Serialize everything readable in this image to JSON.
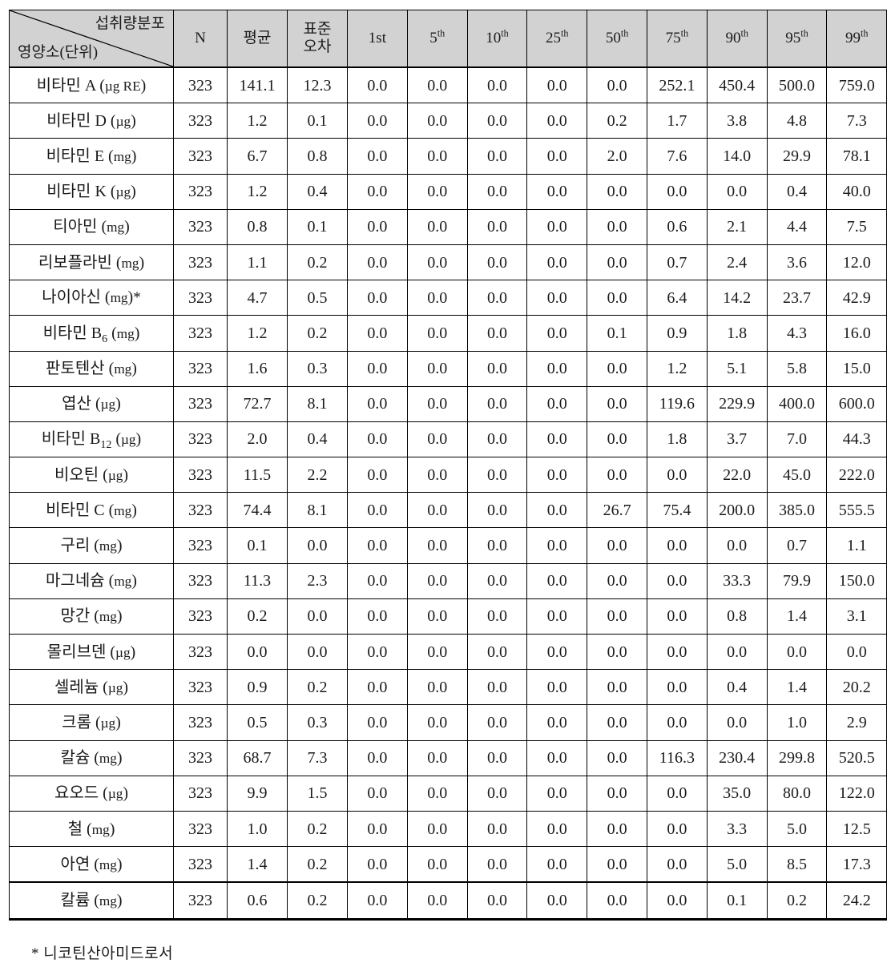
{
  "table": {
    "corner": {
      "top_label": "섭취량분포",
      "bottom_label": "영양소(단위)"
    },
    "columns": [
      {
        "key": "n",
        "label": "N",
        "sup": ""
      },
      {
        "key": "mean",
        "label": "평균",
        "sup": ""
      },
      {
        "key": "se",
        "label": "표준\n오차",
        "line1": "표준",
        "line2": "오차",
        "sup": ""
      },
      {
        "key": "p1",
        "label": "1st",
        "sup": ""
      },
      {
        "key": "p5",
        "label": "5",
        "sup": "th"
      },
      {
        "key": "p10",
        "label": "10",
        "sup": "th"
      },
      {
        "key": "p25",
        "label": "25",
        "sup": "th"
      },
      {
        "key": "p50",
        "label": "50",
        "sup": "th"
      },
      {
        "key": "p75",
        "label": "75",
        "sup": "th"
      },
      {
        "key": "p90",
        "label": "90",
        "sup": "th"
      },
      {
        "key": "p95",
        "label": "95",
        "sup": "th"
      },
      {
        "key": "p99",
        "label": "99",
        "sup": "th"
      }
    ],
    "rows": [
      {
        "name": "비타민 A",
        "unit": "µg RE",
        "marker": "",
        "sub": "",
        "values": [
          "323",
          "141.1",
          "12.3",
          "0.0",
          "0.0",
          "0.0",
          "0.0",
          "0.0",
          "252.1",
          "450.4",
          "500.0",
          "759.0"
        ]
      },
      {
        "name": "비타민 D",
        "unit": "µg",
        "marker": "",
        "sub": "",
        "values": [
          "323",
          "1.2",
          "0.1",
          "0.0",
          "0.0",
          "0.0",
          "0.0",
          "0.2",
          "1.7",
          "3.8",
          "4.8",
          "7.3"
        ]
      },
      {
        "name": "비타민 E",
        "unit": "mg",
        "marker": "",
        "sub": "",
        "values": [
          "323",
          "6.7",
          "0.8",
          "0.0",
          "0.0",
          "0.0",
          "0.0",
          "2.0",
          "7.6",
          "14.0",
          "29.9",
          "78.1"
        ]
      },
      {
        "name": "비타민 K",
        "unit": "µg",
        "marker": "",
        "sub": "",
        "values": [
          "323",
          "1.2",
          "0.4",
          "0.0",
          "0.0",
          "0.0",
          "0.0",
          "0.0",
          "0.0",
          "0.0",
          "0.4",
          "40.0"
        ]
      },
      {
        "name": "티아민",
        "unit": "mg",
        "marker": "",
        "sub": "",
        "values": [
          "323",
          "0.8",
          "0.1",
          "0.0",
          "0.0",
          "0.0",
          "0.0",
          "0.0",
          "0.6",
          "2.1",
          "4.4",
          "7.5"
        ]
      },
      {
        "name": "리보플라빈",
        "unit": "mg",
        "marker": "",
        "sub": "",
        "values": [
          "323",
          "1.1",
          "0.2",
          "0.0",
          "0.0",
          "0.0",
          "0.0",
          "0.0",
          "0.7",
          "2.4",
          "3.6",
          "12.0"
        ]
      },
      {
        "name": "나이아신",
        "unit": "mg",
        "marker": "*",
        "sub": "",
        "values": [
          "323",
          "4.7",
          "0.5",
          "0.0",
          "0.0",
          "0.0",
          "0.0",
          "0.0",
          "6.4",
          "14.2",
          "23.7",
          "42.9"
        ]
      },
      {
        "name": "비타민 B",
        "unit": "mg",
        "marker": "",
        "sub": "6",
        "values": [
          "323",
          "1.2",
          "0.2",
          "0.0",
          "0.0",
          "0.0",
          "0.0",
          "0.1",
          "0.9",
          "1.8",
          "4.3",
          "16.0"
        ]
      },
      {
        "name": "판토텐산",
        "unit": "mg",
        "marker": "",
        "sub": "",
        "values": [
          "323",
          "1.6",
          "0.3",
          "0.0",
          "0.0",
          "0.0",
          "0.0",
          "0.0",
          "1.2",
          "5.1",
          "5.8",
          "15.0"
        ]
      },
      {
        "name": "엽산",
        "unit": "µg",
        "marker": "",
        "sub": "",
        "values": [
          "323",
          "72.7",
          "8.1",
          "0.0",
          "0.0",
          "0.0",
          "0.0",
          "0.0",
          "119.6",
          "229.9",
          "400.0",
          "600.0"
        ]
      },
      {
        "name": "비타민 B",
        "unit": "µg",
        "marker": "",
        "sub": "12",
        "values": [
          "323",
          "2.0",
          "0.4",
          "0.0",
          "0.0",
          "0.0",
          "0.0",
          "0.0",
          "1.8",
          "3.7",
          "7.0",
          "44.3"
        ]
      },
      {
        "name": "비오틴",
        "unit": "µg",
        "marker": "",
        "sub": "",
        "values": [
          "323",
          "11.5",
          "2.2",
          "0.0",
          "0.0",
          "0.0",
          "0.0",
          "0.0",
          "0.0",
          "22.0",
          "45.0",
          "222.0"
        ]
      },
      {
        "name": "비타민 C",
        "unit": "mg",
        "marker": "",
        "sub": "",
        "values": [
          "323",
          "74.4",
          "8.1",
          "0.0",
          "0.0",
          "0.0",
          "0.0",
          "26.7",
          "75.4",
          "200.0",
          "385.0",
          "555.5"
        ]
      },
      {
        "name": "구리",
        "unit": "mg",
        "marker": "",
        "sub": "",
        "values": [
          "323",
          "0.1",
          "0.0",
          "0.0",
          "0.0",
          "0.0",
          "0.0",
          "0.0",
          "0.0",
          "0.0",
          "0.7",
          "1.1"
        ]
      },
      {
        "name": "마그네슘",
        "unit": "mg",
        "marker": "",
        "sub": "",
        "values": [
          "323",
          "11.3",
          "2.3",
          "0.0",
          "0.0",
          "0.0",
          "0.0",
          "0.0",
          "0.0",
          "33.3",
          "79.9",
          "150.0"
        ]
      },
      {
        "name": "망간",
        "unit": "mg",
        "marker": "",
        "sub": "",
        "values": [
          "323",
          "0.2",
          "0.0",
          "0.0",
          "0.0",
          "0.0",
          "0.0",
          "0.0",
          "0.0",
          "0.8",
          "1.4",
          "3.1"
        ]
      },
      {
        "name": "몰리브덴",
        "unit": "µg",
        "marker": "",
        "sub": "",
        "values": [
          "323",
          "0.0",
          "0.0",
          "0.0",
          "0.0",
          "0.0",
          "0.0",
          "0.0",
          "0.0",
          "0.0",
          "0.0",
          "0.0"
        ]
      },
      {
        "name": "셀레늄",
        "unit": "µg",
        "marker": "",
        "sub": "",
        "values": [
          "323",
          "0.9",
          "0.2",
          "0.0",
          "0.0",
          "0.0",
          "0.0",
          "0.0",
          "0.0",
          "0.4",
          "1.4",
          "20.2"
        ]
      },
      {
        "name": "크롬",
        "unit": "µg",
        "marker": "",
        "sub": "",
        "values": [
          "323",
          "0.5",
          "0.3",
          "0.0",
          "0.0",
          "0.0",
          "0.0",
          "0.0",
          "0.0",
          "0.0",
          "1.0",
          "2.9"
        ]
      },
      {
        "name": "칼슘",
        "unit": "mg",
        "marker": "",
        "sub": "",
        "values": [
          "323",
          "68.7",
          "7.3",
          "0.0",
          "0.0",
          "0.0",
          "0.0",
          "0.0",
          "116.3",
          "230.4",
          "299.8",
          "520.5"
        ]
      },
      {
        "name": "요오드",
        "unit": "µg",
        "marker": "",
        "sub": "",
        "values": [
          "323",
          "9.9",
          "1.5",
          "0.0",
          "0.0",
          "0.0",
          "0.0",
          "0.0",
          "0.0",
          "35.0",
          "80.0",
          "122.0"
        ]
      },
      {
        "name": "철",
        "unit": "mg",
        "marker": "",
        "sub": "",
        "values": [
          "323",
          "1.0",
          "0.2",
          "0.0",
          "0.0",
          "0.0",
          "0.0",
          "0.0",
          "0.0",
          "3.3",
          "5.0",
          "12.5"
        ]
      },
      {
        "name": "아연",
        "unit": "mg",
        "marker": "",
        "sub": "",
        "values": [
          "323",
          "1.4",
          "0.2",
          "0.0",
          "0.0",
          "0.0",
          "0.0",
          "0.0",
          "0.0",
          "5.0",
          "8.5",
          "17.3"
        ]
      },
      {
        "name": "칼륨",
        "unit": "mg",
        "marker": "",
        "sub": "",
        "values": [
          "323",
          "0.6",
          "0.2",
          "0.0",
          "0.0",
          "0.0",
          "0.0",
          "0.0",
          "0.0",
          "0.1",
          "0.2",
          "24.2"
        ]
      }
    ]
  },
  "footnote": "* 니코틴산아미드로서"
}
